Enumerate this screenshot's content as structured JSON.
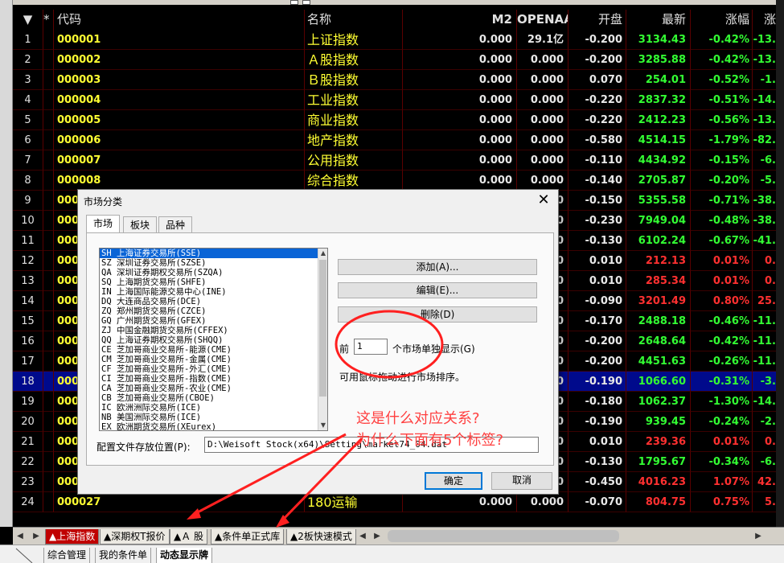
{
  "table": {
    "headers": {
      "no": "▼",
      "star": "*",
      "code": "代码",
      "name": "名称",
      "m2": "M2",
      "openaa": "OPENAA",
      "open": "开盘",
      "last": "最新",
      "pct": "涨幅",
      "chg": "涨"
    },
    "rows": [
      {
        "no": "1",
        "code": "000001",
        "name": "上证指数",
        "m2": "0.000",
        "openaa": "29.1亿",
        "open": "-0.200",
        "last": "3134.43",
        "pct": "-0.42%",
        "chg": "-13.",
        "dir": "down"
      },
      {
        "no": "2",
        "code": "000002",
        "name": "Ａ股指数",
        "m2": "0.000",
        "openaa": "0.000",
        "open": "-0.200",
        "last": "3285.88",
        "pct": "-0.42%",
        "chg": "-13.",
        "dir": "down"
      },
      {
        "no": "3",
        "code": "000003",
        "name": "Ｂ股指数",
        "m2": "0.000",
        "openaa": "0.000",
        "open": "0.070",
        "last": "254.01",
        "pct": "-0.52%",
        "chg": "-1.",
        "dir": "down"
      },
      {
        "no": "4",
        "code": "000004",
        "name": "工业指数",
        "m2": "0.000",
        "openaa": "0.000",
        "open": "-0.220",
        "last": "2837.32",
        "pct": "-0.51%",
        "chg": "-14.",
        "dir": "down"
      },
      {
        "no": "5",
        "code": "000005",
        "name": "商业指数",
        "m2": "0.000",
        "openaa": "0.000",
        "open": "-0.220",
        "last": "2412.23",
        "pct": "-0.56%",
        "chg": "-13.",
        "dir": "down"
      },
      {
        "no": "6",
        "code": "000006",
        "name": "地产指数",
        "m2": "0.000",
        "openaa": "0.000",
        "open": "-0.580",
        "last": "4514.15",
        "pct": "-1.79%",
        "chg": "-82.",
        "dir": "down"
      },
      {
        "no": "7",
        "code": "000007",
        "name": "公用指数",
        "m2": "0.000",
        "openaa": "0.000",
        "open": "-0.110",
        "last": "4434.92",
        "pct": "-0.15%",
        "chg": "-6.",
        "dir": "down"
      },
      {
        "no": "8",
        "code": "000008",
        "name": "综合指数",
        "m2": "0.000",
        "openaa": "0.000",
        "open": "-0.140",
        "last": "2705.87",
        "pct": "-0.20%",
        "chg": "-5.",
        "dir": "down"
      },
      {
        "no": "9",
        "code": "0000",
        "name": "",
        "m2": "",
        "openaa": "00",
        "open": "-0.150",
        "last": "5355.58",
        "pct": "-0.71%",
        "chg": "-38.",
        "dir": "down"
      },
      {
        "no": "10",
        "code": "0000",
        "name": "",
        "m2": "",
        "openaa": "00",
        "open": "-0.230",
        "last": "7949.04",
        "pct": "-0.48%",
        "chg": "-38.",
        "dir": "down"
      },
      {
        "no": "11",
        "code": "0000",
        "name": "",
        "m2": "",
        "openaa": "00",
        "open": "-0.130",
        "last": "6102.24",
        "pct": "-0.67%",
        "chg": "-41.",
        "dir": "down"
      },
      {
        "no": "12",
        "code": "0000",
        "name": "",
        "m2": "",
        "openaa": "00",
        "open": "0.010",
        "last": "212.13",
        "pct": "0.01%",
        "chg": "0.",
        "dir": "up"
      },
      {
        "no": "13",
        "code": "0000",
        "name": "",
        "m2": "",
        "openaa": "00",
        "open": "0.010",
        "last": "285.34",
        "pct": "0.01%",
        "chg": "0.",
        "dir": "up"
      },
      {
        "no": "14",
        "code": "0000",
        "name": "",
        "m2": "",
        "openaa": "00",
        "open": "-0.090",
        "last": "3201.49",
        "pct": "0.80%",
        "chg": "25.",
        "dir": "up"
      },
      {
        "no": "15",
        "code": "0000",
        "name": "",
        "m2": "",
        "openaa": "00",
        "open": "-0.170",
        "last": "2488.18",
        "pct": "-0.46%",
        "chg": "-11.",
        "dir": "down"
      },
      {
        "no": "16",
        "code": "0000",
        "name": "",
        "m2": "",
        "openaa": "00",
        "open": "-0.200",
        "last": "2648.64",
        "pct": "-0.42%",
        "chg": "-11.",
        "dir": "down"
      },
      {
        "no": "17",
        "code": "0000",
        "name": "",
        "m2": "",
        "openaa": "00",
        "open": "-0.200",
        "last": "4451.63",
        "pct": "-0.26%",
        "chg": "-11.",
        "dir": "down"
      },
      {
        "no": "18",
        "code": "0000",
        "name": "",
        "m2": "",
        "openaa": "00",
        "open": "-0.190",
        "last": "1066.60",
        "pct": "-0.31%",
        "chg": "-3.",
        "dir": "down",
        "selected": true
      },
      {
        "no": "19",
        "code": "0000",
        "name": "",
        "m2": "",
        "openaa": "00",
        "open": "-0.180",
        "last": "1062.37",
        "pct": "-1.30%",
        "chg": "-14.",
        "dir": "down"
      },
      {
        "no": "20",
        "code": "0000",
        "name": "",
        "m2": "",
        "openaa": "00",
        "open": "-0.190",
        "last": "939.45",
        "pct": "-0.24%",
        "chg": "-2.",
        "dir": "down"
      },
      {
        "no": "21",
        "code": "0000",
        "name": "",
        "m2": "",
        "openaa": "00",
        "open": "0.010",
        "last": "239.36",
        "pct": "0.01%",
        "chg": "0.",
        "dir": "up"
      },
      {
        "no": "22",
        "code": "0000",
        "name": "",
        "m2": "",
        "openaa": "00",
        "open": "-0.130",
        "last": "1795.67",
        "pct": "-0.34%",
        "chg": "-6.",
        "dir": "down"
      },
      {
        "no": "23",
        "code": "0000",
        "name": "",
        "m2": "",
        "openaa": "00",
        "open": "-0.450",
        "last": "4016.23",
        "pct": "1.07%",
        "chg": "42.",
        "dir": "up"
      },
      {
        "no": "24",
        "code": "000027",
        "name": "180运输",
        "m2": "0.000",
        "openaa": "0.000",
        "open": "-0.070",
        "last": "804.75",
        "pct": "0.75%",
        "chg": "5.",
        "dir": "up"
      }
    ]
  },
  "sheet_tabs": [
    "▲上海指数",
    "▲深期权T报价",
    "▲Ａ 股",
    "▲条件单正式库",
    "▲2板快速模式"
  ],
  "bottom_tabs": [
    "综合管理",
    "我的条件单",
    "动态显示牌"
  ],
  "dialog": {
    "title": "市场分类",
    "close": "✕",
    "tabs": [
      "市场",
      "板块",
      "品种"
    ],
    "markets": [
      "SH 上海证券交易所(SSE)",
      "SZ 深圳证券交易所(SZSE)",
      "QA 深圳证券期权交易所(SZQA)",
      "SQ 上海期货交易所(SHFE)",
      "IN 上海国际能源交易中心(INE)",
      "DQ 大连商品交易所(DCE)",
      "ZQ 郑州期货交易所(CZCE)",
      "GQ 广州期货交易所(GFEX)",
      "ZJ 中国金融期货交易所(CFFEX)",
      "QQ 上海证券期权交易所(SHQQ)",
      "CE 芝加哥商业交易所-能源(CME)",
      "CM 芝加哥商业交易所-金属(CME)",
      "CF 芝加哥商业交易所-外汇(CME)",
      "CI 芝加哥商业交易所-指数(CME)",
      "CA 芝加哥商业交易所-农业(CME)",
      "CB 芝加哥商业交易所(CBOE)",
      "IC 欧洲洲际交易所(ICE)",
      "NB 美国洲际交易所(ICE)",
      "EX 欧洲期货交易所(XEurex)"
    ],
    "buttons": {
      "add": "添加(A)...",
      "edit": "编辑(E)...",
      "delete": "删除(D)",
      "ok": "确定",
      "cancel": "取消"
    },
    "front_label": "前",
    "front_value": "1",
    "front_suffix": "个市场单独显示(G)",
    "hint": "可用鼠标拖动进行市场排序。",
    "config_label": "配置文件存放位置(P):",
    "config_path": "D:\\Weisoft Stock(x64)\\Setting\\market74_04.dat"
  },
  "annotation": {
    "line1": "这是什么对应关系?",
    "line2": "为什么下面有5个标签?",
    "color": "#ff2020"
  },
  "colors": {
    "up": "#ff3030",
    "down": "#33ff33",
    "code": "#ffff33",
    "selected_row": "#000a8c",
    "active_tab": "#c00000"
  }
}
